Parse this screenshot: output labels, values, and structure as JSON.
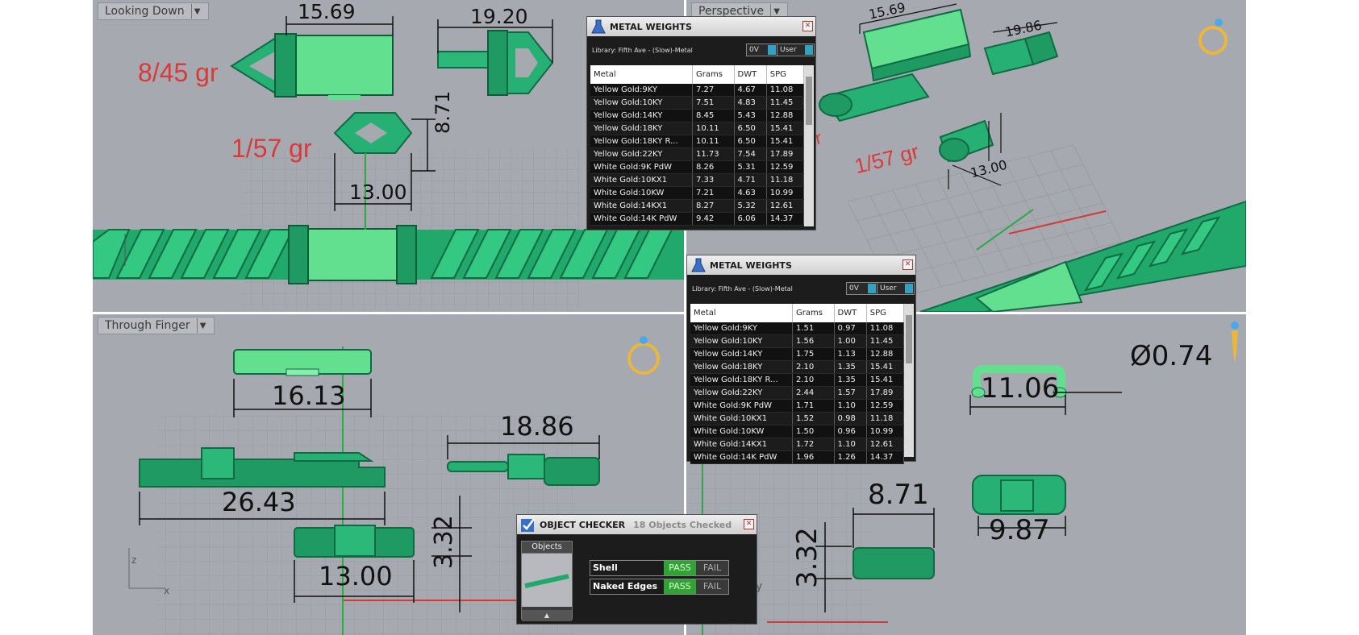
{
  "viewports": {
    "top_left": {
      "label": "Looking Down"
    },
    "top_right": {
      "label": "Perspective"
    },
    "bottom_left": {
      "label": "Through Finger"
    }
  },
  "dimensions": {
    "td_15_69": "15.69",
    "td_19_20": "19.20",
    "td_8_71": "8.71",
    "td_13_00": "13.00",
    "tf_16_13": "16.13",
    "tf_18_86": "18.86",
    "tf_26_43": "26.43",
    "tf_3_32": "3.32",
    "tf_13_00": "13.00",
    "br_0_74": "Ø0.74",
    "br_11_06": "11.06",
    "br_8_71": "8.71",
    "br_3_32": "3.32",
    "br_9_87": "9.87",
    "pv_15_69": "15.69",
    "pv_19_86": "19.86",
    "pv_13_00": "13.00"
  },
  "weights": {
    "w1": "8/45 gr",
    "w2": "1/57 gr",
    "w3": "1/57 gr",
    "w3_partial": "gr"
  },
  "axes": {
    "z": "z",
    "x": "x",
    "y": "y"
  },
  "metal_weights_1": {
    "title": "METAL WEIGHTS",
    "library": "Library: Fifth Ave - (Slow)-Metal",
    "sel1": "0V",
    "sel2": "User",
    "headers": [
      "Metal",
      "Grams",
      "DWT",
      "SPG"
    ],
    "rows": [
      [
        "Yellow Gold:9KY",
        "7.27",
        "4.67",
        "11.08"
      ],
      [
        "Yellow Gold:10KY",
        "7.51",
        "4.83",
        "11.45"
      ],
      [
        "Yellow Gold:14KY",
        "8.45",
        "5.43",
        "12.88"
      ],
      [
        "Yellow Gold:18KY",
        "10.11",
        "6.50",
        "15.41"
      ],
      [
        "Yellow Gold:18KY R...",
        "10.11",
        "6.50",
        "15.41"
      ],
      [
        "Yellow Gold:22KY",
        "11.73",
        "7.54",
        "17.89"
      ],
      [
        "White Gold:9K PdW",
        "8.26",
        "5.31",
        "12.59"
      ],
      [
        "White Gold:10KX1",
        "7.33",
        "4.71",
        "11.18"
      ],
      [
        "White Gold:10KW",
        "7.21",
        "4.63",
        "10.99"
      ],
      [
        "White Gold:14KX1",
        "8.27",
        "5.32",
        "12.61"
      ],
      [
        "White Gold:14K PdW",
        "9.42",
        "6.06",
        "14.37"
      ]
    ]
  },
  "metal_weights_2": {
    "title": "METAL WEIGHTS",
    "library": "Library: Fifth Ave - (Slow)-Metal",
    "sel1": "0V",
    "sel2": "User",
    "headers": [
      "Metal",
      "Grams",
      "DWT",
      "SPG"
    ],
    "rows": [
      [
        "Yellow Gold:9KY",
        "1.51",
        "0.97",
        "11.08"
      ],
      [
        "Yellow Gold:10KY",
        "1.56",
        "1.00",
        "11.45"
      ],
      [
        "Yellow Gold:14KY",
        "1.75",
        "1.13",
        "12.88"
      ],
      [
        "Yellow Gold:18KY",
        "2.10",
        "1.35",
        "15.41"
      ],
      [
        "Yellow Gold:18KY R...",
        "2.10",
        "1.35",
        "15.41"
      ],
      [
        "Yellow Gold:22KY",
        "2.44",
        "1.57",
        "17.89"
      ],
      [
        "White Gold:9K PdW",
        "1.71",
        "1.10",
        "12.59"
      ],
      [
        "White Gold:10KX1",
        "1.52",
        "0.98",
        "11.18"
      ],
      [
        "White Gold:10KW",
        "1.50",
        "0.96",
        "10.99"
      ],
      [
        "White Gold:14KX1",
        "1.72",
        "1.10",
        "12.61"
      ],
      [
        "White Gold:14K PdW",
        "1.96",
        "1.26",
        "14.37"
      ]
    ]
  },
  "object_checker": {
    "title": "OBJECT CHECKER",
    "status": "18 Objects Checked",
    "objects_label": "Objects",
    "rows": [
      {
        "label": "Shell",
        "pass": "PASS",
        "fail": "FAIL"
      },
      {
        "label": "Naked Edges",
        "pass": "PASS",
        "fail": "FAIL"
      }
    ]
  }
}
